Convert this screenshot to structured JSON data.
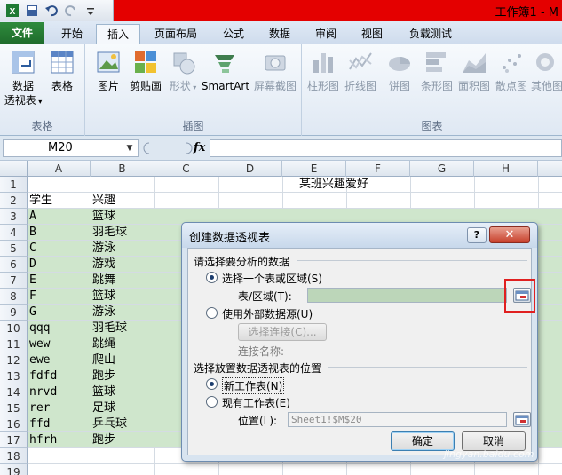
{
  "titlebar": {
    "title": "工作簿1 - M"
  },
  "tabs": [
    {
      "label": "文件"
    },
    {
      "label": "开始"
    },
    {
      "label": "插入"
    },
    {
      "label": "页面布局"
    },
    {
      "label": "公式"
    },
    {
      "label": "数据"
    },
    {
      "label": "审阅"
    },
    {
      "label": "视图"
    },
    {
      "label": "负载测试"
    }
  ],
  "ribbon": {
    "groups": {
      "tables": "表格",
      "illustrations": "插图",
      "charts": "图表"
    },
    "buttons": {
      "pivot_line1": "数据",
      "pivot_line2": "透视表",
      "table": "表格",
      "picture": "图片",
      "clipart": "剪贴画",
      "shapes": "形状",
      "smartart": "SmartArt",
      "screenshot": "屏幕截图",
      "column": "柱形图",
      "line": "折线图",
      "pie": "饼图",
      "bar": "条形图",
      "area": "面积图",
      "scatter": "散点图",
      "other": "其他图"
    }
  },
  "formula": {
    "namebox": "M20",
    "fx": "fx",
    "content": ""
  },
  "sheet": {
    "columns": [
      "A",
      "B",
      "C",
      "D",
      "E",
      "F",
      "G",
      "H"
    ],
    "rows": [
      "1",
      "2",
      "3",
      "4",
      "5",
      "6",
      "7",
      "8",
      "9",
      "10",
      "11",
      "12",
      "13",
      "14",
      "15",
      "16",
      "17",
      "18",
      "19"
    ],
    "title": "某班兴趣爱好",
    "header": [
      "学生",
      "兴趣"
    ],
    "data": [
      [
        "A",
        "篮球"
      ],
      [
        "B",
        "羽毛球"
      ],
      [
        "C",
        "游泳"
      ],
      [
        "D",
        "游戏"
      ],
      [
        "E",
        "跳舞"
      ],
      [
        "F",
        "篮球"
      ],
      [
        "G",
        "游泳"
      ],
      [
        "qqq",
        "羽毛球"
      ],
      [
        "wew",
        "跳绳"
      ],
      [
        "ewe",
        "爬山"
      ],
      [
        "fdfd",
        "跑步"
      ],
      [
        "nrvd",
        "篮球"
      ],
      [
        "rer",
        "足球"
      ],
      [
        "ffd",
        "乒乓球"
      ],
      [
        "hfrh",
        "跑步"
      ]
    ]
  },
  "dialog": {
    "title": "创建数据透视表",
    "help": "?",
    "close": "✕",
    "section1": "请选择要分析的数据",
    "opt_range": "选择一个表或区域(S)",
    "range_label": "表/区域(T):",
    "range_value": "",
    "opt_external": "使用外部数据源(U)",
    "choose_conn": "选择连接(C)...",
    "conn_name": "连接名称:",
    "section2": "选择放置数据透视表的位置",
    "opt_new": "新工作表(N)",
    "opt_existing": "现有工作表(E)",
    "location_label": "位置(L):",
    "location_value": "Sheet1!$M$20",
    "ok": "确定",
    "cancel": "取消"
  },
  "watermark": "jingyan.baidu.com",
  "colors": {
    "accent_red": "#e40000",
    "file_tab": "#2f8b3d",
    "row_green": "#cfe6cc",
    "highlight_box": "#e02020"
  }
}
